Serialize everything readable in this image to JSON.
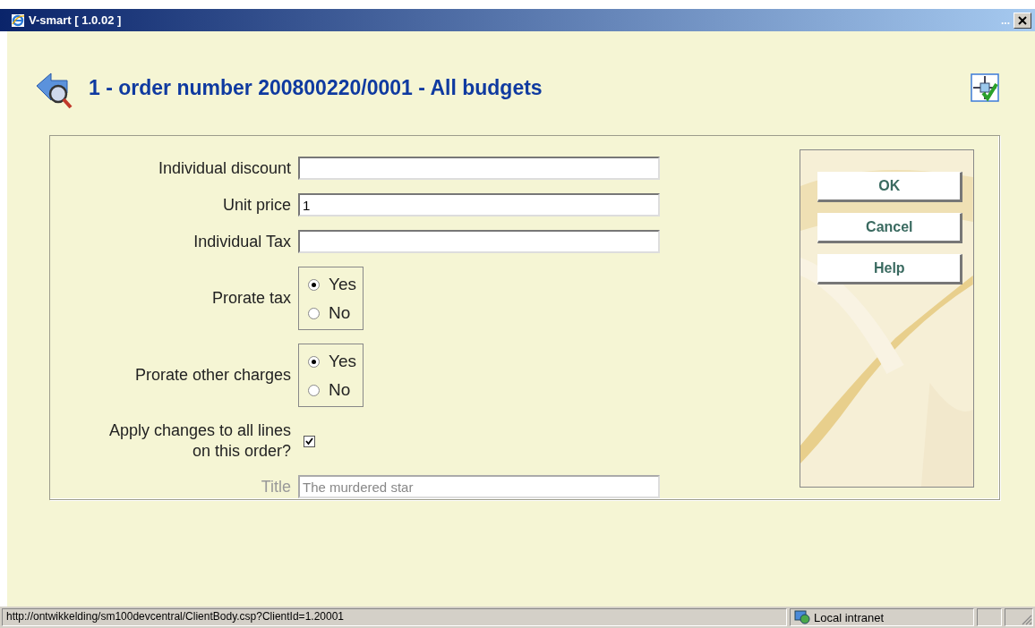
{
  "window": {
    "title": "V-smart [ 1.0.02 ]",
    "overflow": "..."
  },
  "heading": "1 - order number 200800220/0001 - All budgets",
  "fields": [
    {
      "kind": "text",
      "label": "Individual discount",
      "disabled": false
    },
    {
      "kind": "text",
      "label": "Unit price",
      "value": "1",
      "disabled": false
    },
    {
      "kind": "text",
      "label": "Individual Tax",
      "disabled": false
    },
    {
      "kind": "radio",
      "label": "Prorate tax",
      "options": [
        {
          "label": "Yes",
          "selected": true
        },
        {
          "label": "No",
          "selected": false
        }
      ]
    },
    {
      "kind": "radio",
      "label": "Prorate other charges",
      "options": [
        {
          "label": "Yes",
          "selected": true
        },
        {
          "label": "No",
          "selected": false
        }
      ]
    },
    {
      "kind": "checkbox",
      "label": "Apply changes to all lines on this order?",
      "checked": true
    },
    {
      "kind": "text",
      "label": "Title",
      "value": "The murdered star",
      "disabled": true
    }
  ],
  "buttons": [
    "OK",
    "Cancel",
    "Help"
  ],
  "status_bar": {
    "url": "http://ontwikkelding/sm100devcentral/ClientBody.csp?ClientId=1.20001",
    "zone": "Local intranet"
  }
}
